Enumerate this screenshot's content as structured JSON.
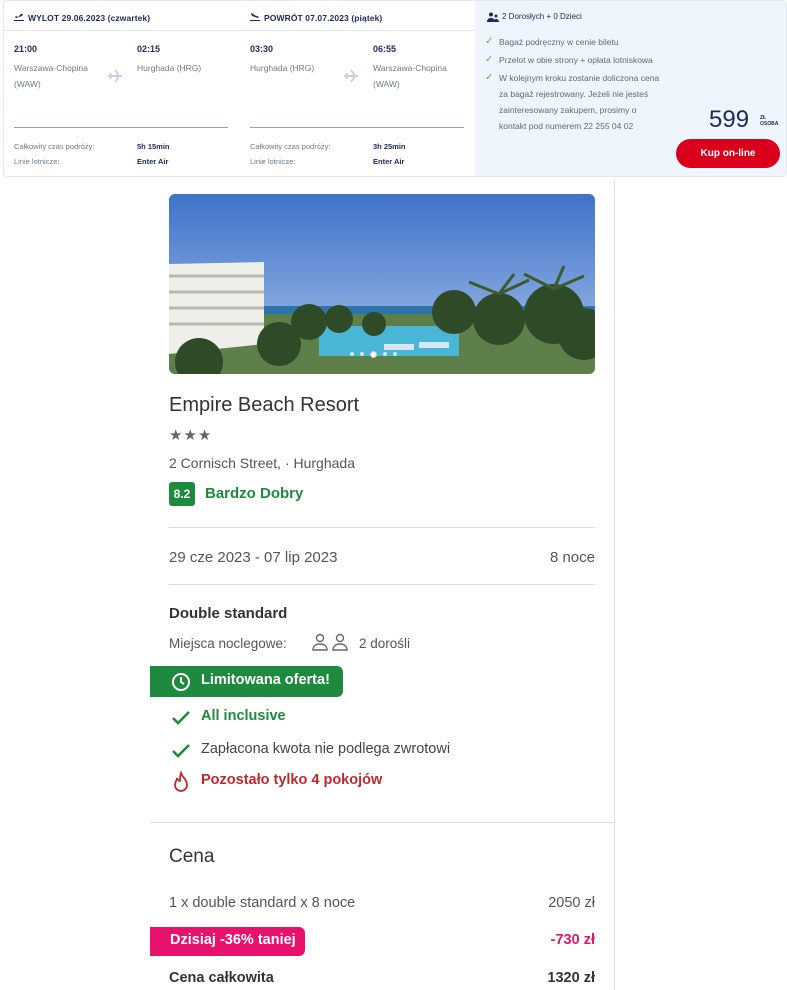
{
  "flight": {
    "outbound": {
      "header": "WYLOT 29.06.2023",
      "day": "(czwartek)",
      "dep_time": "21:00",
      "dep_place": "Warszawa-Chopina (WAW)",
      "arr_time": "02:15",
      "arr_place": "Hurghada (HRG)",
      "duration_label": "Całkowity czas podróży:",
      "duration": "5h 15min",
      "airline_label": "Linie lotnicze:",
      "airline": "Enter Air"
    },
    "return": {
      "header": "POWRÓT 07.07.2023",
      "day": "(piątek)",
      "dep_time": "03:30",
      "dep_place": "Hurghada (HRG)",
      "arr_time": "06:55",
      "arr_place": "Warszawa-Chopina (WAW)",
      "duration_label": "Całkowity czas podróży:",
      "duration": "3h 25min",
      "airline_label": "Linie lotnicze:",
      "airline": "Enter Air"
    },
    "passengers": "2 Dorosłych + 0 Dzieci",
    "bullets": [
      "Bagaż podręczny w cenie biletu",
      "Przelot w obie strony + opłata lotniskowa",
      "W kolejnym kroku zostanie doliczona cena za bagaż rejestrowany. Jeżeli nie jesteś zainteresowany zakupem, prosimy o kontakt pod numerem 22 255 04 02"
    ],
    "price": "599",
    "price_currency": "ZŁ",
    "price_per": "OSOBA",
    "buy_label": "Kup on-line"
  },
  "hotel": {
    "name": "Empire Beach Resort",
    "stars": 3,
    "stars_text": "★★★",
    "address": "2 Cornisch Street, · Hurghada",
    "score": "8.2",
    "score_label": "Bardzo Dobry",
    "dates": "29 cze 2023 - 07 lip 2023",
    "nights": "8 noce",
    "room_type": "Double standard",
    "beds_label": "Miejsca noclegowe:",
    "beds_value": "2 dorośli",
    "limited_offer": "Limitowana oferta!",
    "board": "All inclusive",
    "refund": "Zapłacona kwota nie podlega zwrotowi",
    "rooms_left": "Pozostało tylko 4 pokojów",
    "gallery_dots": 5,
    "gallery_active": 3
  },
  "price": {
    "title": "Cena",
    "line_label": "1 x double standard x 8 noce",
    "line_value": "2050 zł",
    "discount_label": "Dzisiaj -36% taniej",
    "discount_value": "-730 zł",
    "total_label": "Cena całkowita",
    "total_value": "1320 zł"
  },
  "colors": {
    "navy": "#1d2a5b",
    "green": "#1d8a3e",
    "red_button": "#d9001b",
    "pink": "#e8126d",
    "info_bg": "#eef5fc"
  }
}
